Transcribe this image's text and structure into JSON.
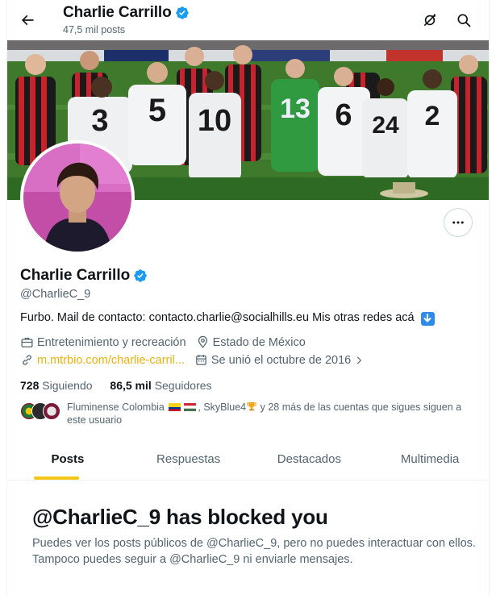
{
  "topbar": {
    "name": "Charlie Carrillo",
    "posts_count": "47,5 mil posts",
    "back_icon": "arrow-left-icon",
    "hide_icon": "no-eye-icon",
    "search_icon": "search-icon"
  },
  "profile": {
    "name": "Charlie Carrillo",
    "handle": "@CharlieC_9",
    "bio": "Furbo. Mail de contacto: contacto.charlie@socialhills.eu Mis otras redes acá",
    "bio_emoji": "down-arrow-emoji",
    "category": "Entretenimiento y recreación",
    "location": "Estado de México",
    "website": "m.mtrbio.com/charlie-carril...",
    "joined": "Se unió el octubre de 2016",
    "following_count": "728",
    "following_label": "Siguiendo",
    "followers_count": "86,5 mil",
    "followers_label": "Seguidores",
    "known_followers_part1": "Fluminense Colombia",
    "known_followers_part2": ", SkyBlue4",
    "known_followers_part3": " y 28 más de las cuentas que sigues siguen a este usuario",
    "accent_color": "#1d9bf0",
    "link_color": "#e9b30f"
  },
  "tabs": [
    {
      "label": "Posts",
      "active": true
    },
    {
      "label": "Respuestas",
      "active": false
    },
    {
      "label": "Destacados",
      "active": false
    },
    {
      "label": "Multimedia",
      "active": false
    }
  ],
  "blocked": {
    "title": "@CharlieC_9 has blocked you",
    "message": "Puedes ver los posts públicos de @CharlieC_9, pero no puedes interactuar con ellos. Tampoco puedes seguir a @CharlieC_9 ni enviarle mensajes."
  }
}
